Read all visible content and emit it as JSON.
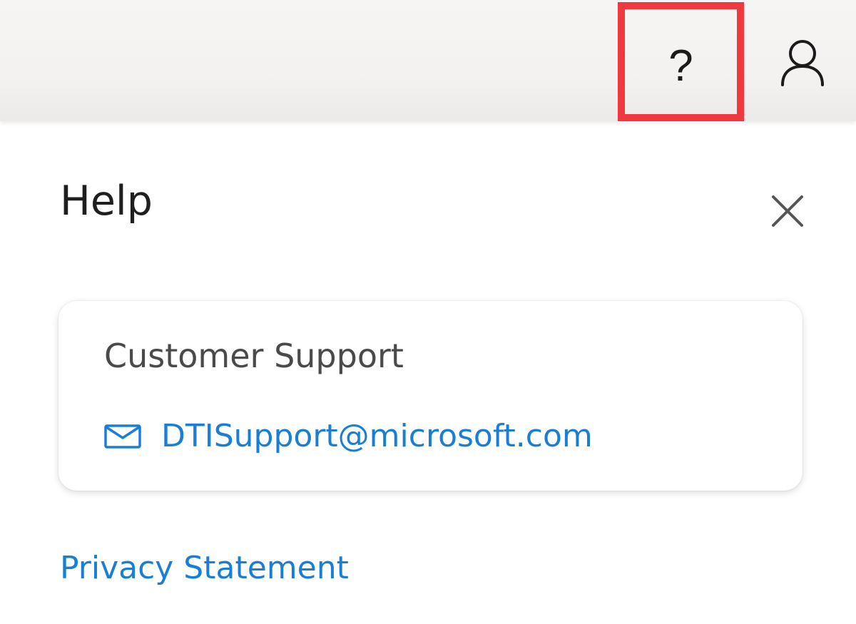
{
  "header": {
    "help_button": {
      "glyph": "?",
      "icon": "question-mark-icon",
      "highlight_color": "#f0393f"
    },
    "account_button": {
      "icon": "person-icon"
    }
  },
  "help_panel": {
    "title": "Help",
    "close_icon": "close-icon",
    "customer_support": {
      "title": "Customer Support",
      "email_icon": "mail-icon",
      "email": "DTISupport@microsoft.com"
    },
    "privacy_statement": "Privacy Statement"
  },
  "colors": {
    "link": "#1a7ed4",
    "header_bg": "#f2f1f0",
    "highlight": "#f0393f"
  }
}
